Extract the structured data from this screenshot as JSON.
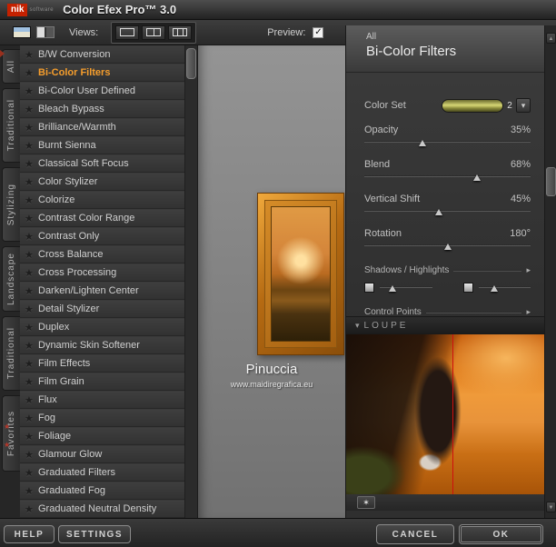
{
  "window": {
    "logo_main": "nik",
    "logo_sub": "software",
    "title": "Color Efex Pro™ 3.0"
  },
  "toolbar": {
    "views_label": "Views:",
    "preview_label": "Preview:",
    "preview_checked": true
  },
  "icons": {
    "star": "★",
    "check": "✓",
    "dropdown_arrow": "▾",
    "section_arrow": "▸",
    "loupe_arrow": "▾",
    "pin": "✶",
    "scroll_up": "▲",
    "scroll_down": "▼"
  },
  "side_tabs": {
    "items": [
      "All",
      "Traditional",
      "Stylizing",
      "Landscape",
      "Traditional",
      "Favorites"
    ]
  },
  "filters": {
    "selected_index": 1,
    "items": [
      "B/W Conversion",
      "Bi-Color Filters",
      "Bi-Color User Defined",
      "Bleach Bypass",
      "Brilliance/Warmth",
      "Burnt Sienna",
      "Classical Soft Focus",
      "Color Stylizer",
      "Colorize",
      "Contrast Color Range",
      "Contrast Only",
      "Cross Balance",
      "Cross Processing",
      "Darken/Lighten Center",
      "Detail Stylizer",
      "Duplex",
      "Dynamic Skin Softener",
      "Film Effects",
      "Film Grain",
      "Flux",
      "Fog",
      "Foliage",
      "Glamour Glow",
      "Graduated Filters",
      "Graduated Fog",
      "Graduated Neutral Density"
    ]
  },
  "panel": {
    "group": "All",
    "title": "Bi-Color Filters",
    "color_set": {
      "label": "Color Set",
      "value": "2"
    },
    "sliders": [
      {
        "label": "Opacity",
        "value": "35%",
        "pos": 0.35
      },
      {
        "label": "Blend",
        "value": "68%",
        "pos": 0.68
      },
      {
        "label": "Vertical Shift",
        "value": "45%",
        "pos": 0.45
      },
      {
        "label": "Rotation",
        "value": "180°",
        "pos": 0.5
      }
    ],
    "mini_sliders": [
      {
        "pos": 0.25
      },
      {
        "pos": 0.3
      }
    ],
    "sections": {
      "shadows_highlights": "Shadows / Highlights",
      "control_points": "Control Points",
      "loupe": "LOUPE"
    }
  },
  "preview": {
    "watermark": "Pinuccia",
    "watermark_url": "www.maidiregrafica.eu"
  },
  "footer": {
    "help": "HELP",
    "settings": "SETTINGS",
    "cancel": "CANCEL",
    "ok": "OK"
  },
  "colors": {
    "accent": "#f59d2c",
    "loupe_line": "#cf0f0f",
    "logo_red": "#c42100"
  }
}
